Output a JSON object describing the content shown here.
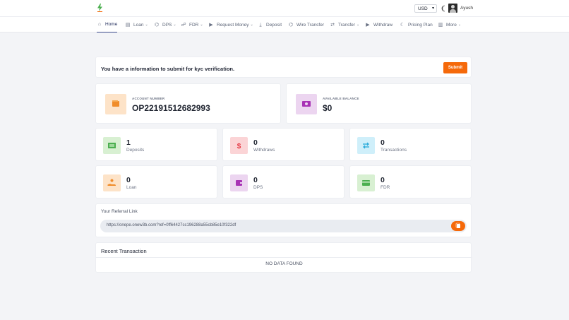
{
  "header": {
    "currency": {
      "value": "USD",
      "options": [
        "USD"
      ]
    },
    "user": {
      "name": "Ayush"
    },
    "colors": {
      "brand": "#f5690a",
      "logo": "#4caf50"
    }
  },
  "nav": {
    "items": [
      {
        "label": "Home",
        "icon": "home-icon",
        "dropdown": false,
        "active": true
      },
      {
        "label": "Loan",
        "icon": "loan-icon",
        "dropdown": true
      },
      {
        "label": "DPS",
        "icon": "bank-icon",
        "dropdown": true
      },
      {
        "label": "FDR",
        "icon": "users-icon",
        "dropdown": true
      },
      {
        "label": "Request Money",
        "icon": "request-money-icon",
        "dropdown": true
      },
      {
        "label": "Deposit",
        "icon": "deposit-icon",
        "dropdown": false
      },
      {
        "label": "Wire Transfer",
        "icon": "bank-icon",
        "dropdown": false
      },
      {
        "label": "Transfer",
        "icon": "transfer-arrows-icon",
        "dropdown": true
      },
      {
        "label": "Withdraw",
        "icon": "withdraw-icon",
        "dropdown": false
      },
      {
        "label": "Pricing Plan",
        "icon": "moon-icon",
        "dropdown": false
      },
      {
        "label": "More",
        "icon": "box-icon",
        "dropdown": true
      }
    ]
  },
  "kyc": {
    "message": "You have a information to submit for kyc verification.",
    "submit_label": "Submit"
  },
  "account": {
    "label": "ACCOUNT NUMBER",
    "value": "OP22191512682993",
    "icon": "wallet-icon"
  },
  "balance": {
    "label": "AVAILABLE BALANCE",
    "value": "$0",
    "icon": "money-icon"
  },
  "stats": [
    {
      "value": "1",
      "label": "Deposits",
      "icon": "cash-icon"
    },
    {
      "value": "0",
      "label": "Withdraws",
      "icon": "dollar-icon"
    },
    {
      "value": "0",
      "label": "Transactions",
      "icon": "transfer-arrows-icon"
    },
    {
      "value": "0",
      "label": "Loan",
      "icon": "hand-coin-icon"
    },
    {
      "value": "0",
      "label": "DPS",
      "icon": "wallet-icon"
    },
    {
      "value": "0",
      "label": "FDR",
      "icon": "card-icon"
    }
  ],
  "referral": {
    "title": "Your Referral Link",
    "link": "https://onepe.onew3b.com?ref=0ff64427cc196288a55cb85e10f322df"
  },
  "recent": {
    "title": "Recent Transaction",
    "empty": "NO DATA FOUND"
  }
}
